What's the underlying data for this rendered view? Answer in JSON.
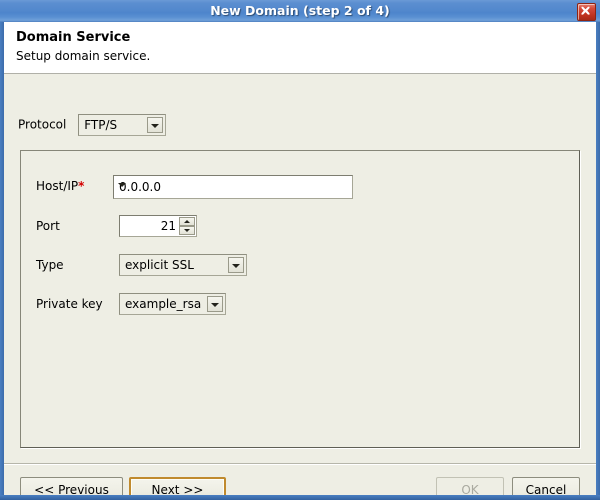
{
  "window": {
    "title": "New Domain (step 2 of 4)",
    "close_icon": "close-icon",
    "accent_titlebar": "#5288cd",
    "close_button_color": "#c0321f",
    "body_background": "#eeeee4",
    "focus_border_color": "#c08a2e",
    "required_marker_color": "#d40000"
  },
  "banner": {
    "title": "Domain Service",
    "subtitle": "Setup domain service."
  },
  "protocol": {
    "label": "Protocol",
    "value": "FTP/S"
  },
  "fields": {
    "host": {
      "label": "Host/IP",
      "required_marker": "*",
      "value": "0.0.0.0",
      "dropdown_icon": "chevron-down-icon"
    },
    "port": {
      "label": "Port",
      "value": "21",
      "up_icon": "spinner-up-icon",
      "down_icon": "spinner-down-icon"
    },
    "type": {
      "label": "Type",
      "value": "explicit SSL",
      "dropdown_icon": "chevron-down-icon"
    },
    "private_key": {
      "label": "Private key",
      "value": "example_rsa",
      "dropdown_icon": "chevron-down-icon"
    }
  },
  "buttons": {
    "previous": {
      "prefix": "<< ",
      "mnemonic": "P",
      "rest": "revious"
    },
    "next": {
      "mnemonic": "N",
      "rest": "ext >>"
    },
    "ok": {
      "mnemonic": "O",
      "rest": "K",
      "disabled": true
    },
    "cancel": {
      "mnemonic": "C",
      "rest": "ancel"
    }
  }
}
